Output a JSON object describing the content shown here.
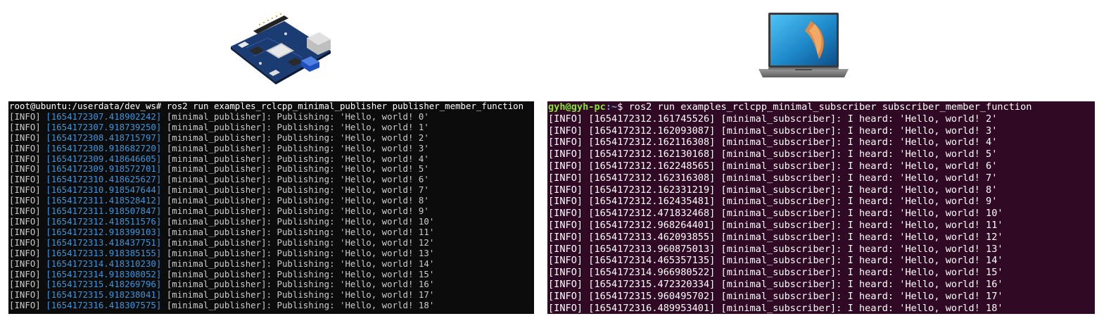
{
  "devices": {
    "left": {
      "name": "dev-board",
      "icon": "single-board-computer-icon"
    },
    "right": {
      "name": "laptop",
      "icon": "laptop-icon"
    }
  },
  "left_terminal": {
    "bg_color": "#0c0c0c",
    "timestamp_color": "#3a96dd",
    "prompt": "root@ubuntu:/userdata/dev_ws#",
    "command": " ros2 run examples_rclcpp_minimal_publisher publisher_member_function",
    "lines": [
      {
        "level": "[INFO]",
        "ts": "[1654172307.418902242]",
        "msg": "[minimal_publisher]: Publishing: 'Hello, world! 0'"
      },
      {
        "level": "[INFO]",
        "ts": "[1654172307.918739250]",
        "msg": "[minimal_publisher]: Publishing: 'Hello, world! 1'"
      },
      {
        "level": "[INFO]",
        "ts": "[1654172308.418715797]",
        "msg": "[minimal_publisher]: Publishing: 'Hello, world! 2'"
      },
      {
        "level": "[INFO]",
        "ts": "[1654172308.918682720]",
        "msg": "[minimal_publisher]: Publishing: 'Hello, world! 3'"
      },
      {
        "level": "[INFO]",
        "ts": "[1654172309.418646605]",
        "msg": "[minimal_publisher]: Publishing: 'Hello, world! 4'"
      },
      {
        "level": "[INFO]",
        "ts": "[1654172309.918572701]",
        "msg": "[minimal_publisher]: Publishing: 'Hello, world! 5'"
      },
      {
        "level": "[INFO]",
        "ts": "[1654172310.418625627]",
        "msg": "[minimal_publisher]: Publishing: 'Hello, world! 6'"
      },
      {
        "level": "[INFO]",
        "ts": "[1654172310.918547644]",
        "msg": "[minimal_publisher]: Publishing: 'Hello, world! 7'"
      },
      {
        "level": "[INFO]",
        "ts": "[1654172311.418528412]",
        "msg": "[minimal_publisher]: Publishing: 'Hello, world! 8'"
      },
      {
        "level": "[INFO]",
        "ts": "[1654172311.918507847]",
        "msg": "[minimal_publisher]: Publishing: 'Hello, world! 9'"
      },
      {
        "level": "[INFO]",
        "ts": "[1654172312.418511576]",
        "msg": "[minimal_publisher]: Publishing: 'Hello, world! 10'"
      },
      {
        "level": "[INFO]",
        "ts": "[1654172312.918399103]",
        "msg": "[minimal_publisher]: Publishing: 'Hello, world! 11'"
      },
      {
        "level": "[INFO]",
        "ts": "[1654172313.418437751]",
        "msg": "[minimal_publisher]: Publishing: 'Hello, world! 12'"
      },
      {
        "level": "[INFO]",
        "ts": "[1654172313.918385155]",
        "msg": "[minimal_publisher]: Publishing: 'Hello, world! 13'"
      },
      {
        "level": "[INFO]",
        "ts": "[1654172314.418310230]",
        "msg": "[minimal_publisher]: Publishing: 'Hello, world! 14'"
      },
      {
        "level": "[INFO]",
        "ts": "[1654172314.918308052]",
        "msg": "[minimal_publisher]: Publishing: 'Hello, world! 15'"
      },
      {
        "level": "[INFO]",
        "ts": "[1654172315.418269796]",
        "msg": "[minimal_publisher]: Publishing: 'Hello, world! 16'"
      },
      {
        "level": "[INFO]",
        "ts": "[1654172315.918238041]",
        "msg": "[minimal_publisher]: Publishing: 'Hello, world! 17'"
      },
      {
        "level": "[INFO]",
        "ts": "[1654172316.418307575]",
        "msg": "[minimal_publisher]: Publishing: 'Hello, world! 18'"
      }
    ]
  },
  "right_terminal": {
    "bg_color": "#300a24",
    "prompt_user": "gyh@gyh-pc",
    "prompt_path": ":~",
    "prompt_symbol": "$",
    "command": " ros2 run examples_rclcpp_minimal_subscriber subscriber_member_function",
    "lines": [
      {
        "level": "[INFO]",
        "ts": "[1654172312.161745526]",
        "msg": "[minimal_subscriber]: I heard: 'Hello, world! 2'"
      },
      {
        "level": "[INFO]",
        "ts": "[1654172312.162093087]",
        "msg": "[minimal_subscriber]: I heard: 'Hello, world! 3'"
      },
      {
        "level": "[INFO]",
        "ts": "[1654172312.162116308]",
        "msg": "[minimal_subscriber]: I heard: 'Hello, world! 4'"
      },
      {
        "level": "[INFO]",
        "ts": "[1654172312.162130168]",
        "msg": "[minimal_subscriber]: I heard: 'Hello, world! 5'"
      },
      {
        "level": "[INFO]",
        "ts": "[1654172312.162248565]",
        "msg": "[minimal_subscriber]: I heard: 'Hello, world! 6'"
      },
      {
        "level": "[INFO]",
        "ts": "[1654172312.162316308]",
        "msg": "[minimal_subscriber]: I heard: 'Hello, world! 7'"
      },
      {
        "level": "[INFO]",
        "ts": "[1654172312.162331219]",
        "msg": "[minimal_subscriber]: I heard: 'Hello, world! 8'"
      },
      {
        "level": "[INFO]",
        "ts": "[1654172312.162435481]",
        "msg": "[minimal_subscriber]: I heard: 'Hello, world! 9'"
      },
      {
        "level": "[INFO]",
        "ts": "[1654172312.471832468]",
        "msg": "[minimal_subscriber]: I heard: 'Hello, world! 10'"
      },
      {
        "level": "[INFO]",
        "ts": "[1654172312.968264401]",
        "msg": "[minimal_subscriber]: I heard: 'Hello, world! 11'"
      },
      {
        "level": "[INFO]",
        "ts": "[1654172313.462093855]",
        "msg": "[minimal_subscriber]: I heard: 'Hello, world! 12'"
      },
      {
        "level": "[INFO]",
        "ts": "[1654172313.960875013]",
        "msg": "[minimal_subscriber]: I heard: 'Hello, world! 13'"
      },
      {
        "level": "[INFO]",
        "ts": "[1654172314.465357135]",
        "msg": "[minimal_subscriber]: I heard: 'Hello, world! 14'"
      },
      {
        "level": "[INFO]",
        "ts": "[1654172314.966980522]",
        "msg": "[minimal_subscriber]: I heard: 'Hello, world! 15'"
      },
      {
        "level": "[INFO]",
        "ts": "[1654172315.472320334]",
        "msg": "[minimal_subscriber]: I heard: 'Hello, world! 16'"
      },
      {
        "level": "[INFO]",
        "ts": "[1654172315.960495702]",
        "msg": "[minimal_subscriber]: I heard: 'Hello, world! 17'"
      },
      {
        "level": "[INFO]",
        "ts": "[1654172316.489953401]",
        "msg": "[minimal_subscriber]: I heard: 'Hello, world! 18'"
      }
    ]
  }
}
